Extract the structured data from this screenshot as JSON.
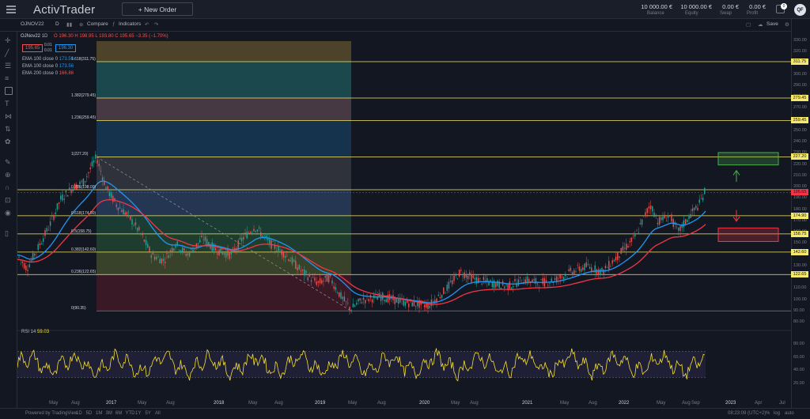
{
  "header": {
    "logo": "ActivTrader",
    "new_order": "+ New Order",
    "stats": [
      {
        "value": "10 000.00 €",
        "label": "Balance"
      },
      {
        "value": "10 000.00 €",
        "label": "Equity"
      },
      {
        "value": "0.00 €",
        "label": "Swap"
      },
      {
        "value": "0.00 €",
        "label": "Profit"
      }
    ],
    "notification_count": "0",
    "avatar": "QF"
  },
  "toolbar": {
    "symbol": "OJNOV22",
    "interval": "D",
    "compare": "Compare",
    "indicators": "Indicators",
    "save": "Save"
  },
  "legend": {
    "symbol": "OJNov22",
    "interval": "1D",
    "ohlc": "O 196.30  H 198.95  L 193.80  C 195.65  −3.35 (−1.70%)",
    "sell_price": "195.65",
    "spread_a": "0.01",
    "spread_b": "0.01",
    "buy_price": "196.30",
    "ema1": "EMA 100 close 0",
    "ema1_val": "173.56",
    "ema2": "EMA 100 close 0",
    "ema2_val": "173.56",
    "ema3": "EMA 200 close 0",
    "ema3_val": "166.86"
  },
  "fib_labels": [
    {
      "text": "1.618(311.75)",
      "price": 311.75
    },
    {
      "text": "1.382(279.45)",
      "price": 279.45
    },
    {
      "text": "1.236(259.45)",
      "price": 259.45
    },
    {
      "text": "1(227.20)",
      "price": 227.2
    },
    {
      "text": "0.786(198.00)",
      "price": 198.0
    },
    {
      "text": "0.618(174.90)",
      "price": 174.9
    },
    {
      "text": "0.5(158.75)",
      "price": 158.75
    },
    {
      "text": "0.382(142.60)",
      "price": 142.6
    },
    {
      "text": "0.236(122.65)",
      "price": 122.65
    },
    {
      "text": "0(90.35)",
      "price": 90.35
    }
  ],
  "price_axis": [
    "330.00",
    "320.00",
    "310.00",
    "300.00",
    "290.00",
    "280.00",
    "270.00",
    "260.00",
    "250.00",
    "240.00",
    "230.00",
    "220.00",
    "210.00",
    "200.00",
    "190.00",
    "180.00",
    "170.00",
    "160.00",
    "150.00",
    "140.00",
    "130.00",
    "120.00",
    "110.00",
    "100.00",
    "90.00",
    "80.00"
  ],
  "price_tags": [
    {
      "text": "311.75",
      "price": 311.75,
      "color": "#f5e86a"
    },
    {
      "text": "279.45",
      "price": 279.45,
      "color": "#f5e86a"
    },
    {
      "text": "259.45",
      "price": 259.45,
      "color": "#f5e86a"
    },
    {
      "text": "227.20",
      "price": 227.2,
      "color": "#f5e86a"
    },
    {
      "text": "195.65",
      "price": 195.65,
      "color": "#f23645"
    },
    {
      "text": "174.90",
      "price": 174.9,
      "color": "#f5e86a"
    },
    {
      "text": "158.75",
      "price": 158.75,
      "color": "#f5e86a"
    },
    {
      "text": "142.60",
      "price": 142.6,
      "color": "#f5e86a"
    },
    {
      "text": "122.65",
      "price": 122.65,
      "color": "#f5e86a"
    }
  ],
  "rsi": {
    "label": "RSI 14",
    "value": "59.03",
    "axis": [
      "80.00",
      "60.00",
      "40.00",
      "20.00"
    ]
  },
  "time_axis": [
    "May",
    "Aug",
    "2017",
    "May",
    "Aug",
    "2018",
    "May",
    "Aug",
    "2019",
    "May",
    "Aug",
    "2020",
    "May",
    "Aug",
    "2021",
    "May",
    "Aug",
    "2022",
    "May",
    "Aug",
    "Sep",
    "2023",
    "Apr",
    "Jul"
  ],
  "bottom": {
    "powered": "Powered by TradingView",
    "ranges": [
      "1D",
      "5D",
      "1M",
      "3M",
      "6M",
      "YTD",
      "1Y",
      "5Y",
      "All"
    ],
    "time": "08:23:09 (UTC+2)",
    "pct": "%",
    "log": "log",
    "auto": "auto"
  },
  "colors": {
    "fib_line": "#f5e86a",
    "ema_blue": "#2196f3",
    "ema_red": "#f23645",
    "rsi": "#f5e030",
    "up": "#26a69a",
    "down": "#ef5350"
  }
}
